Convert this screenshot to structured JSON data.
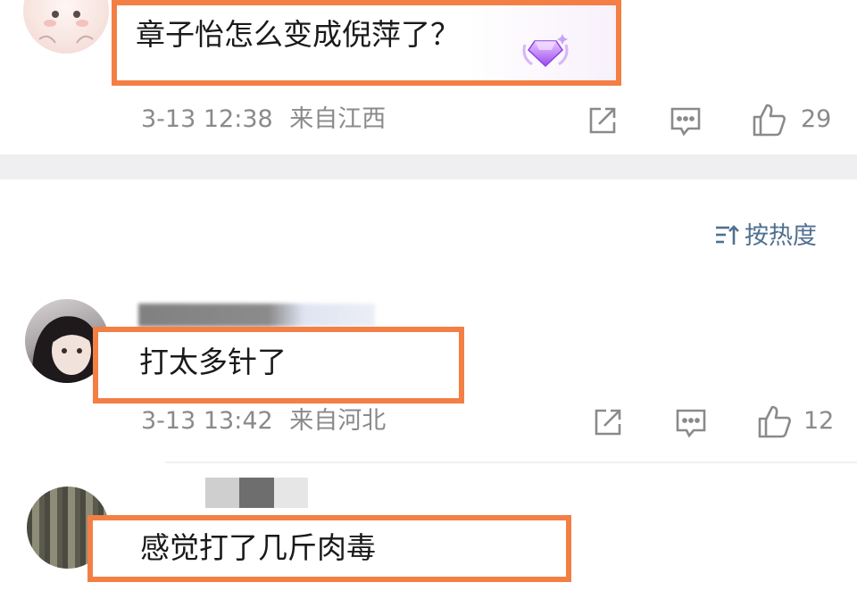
{
  "comments": [
    {
      "text": "章子怡怎么变成倪萍了？",
      "time": "3-13 12:38",
      "location": "来自江西",
      "likes": "29"
    },
    {
      "text": "打太多针了",
      "time": "3-13 13:42",
      "location": "来自河北",
      "likes": "12"
    },
    {
      "text": "感觉打了几斤肉毒"
    }
  ],
  "sort": {
    "label": "按热度",
    "icon": "sort-icon"
  },
  "icons": {
    "share": "share-icon",
    "comment": "comment-icon",
    "like": "thumbs-up-icon",
    "badge": "diamond-badge-icon"
  },
  "colors": {
    "highlight_frame": "#f37f45",
    "meta_text": "#8a8a8a",
    "sort_text": "#4f7090",
    "divider_band": "#efeff1"
  }
}
